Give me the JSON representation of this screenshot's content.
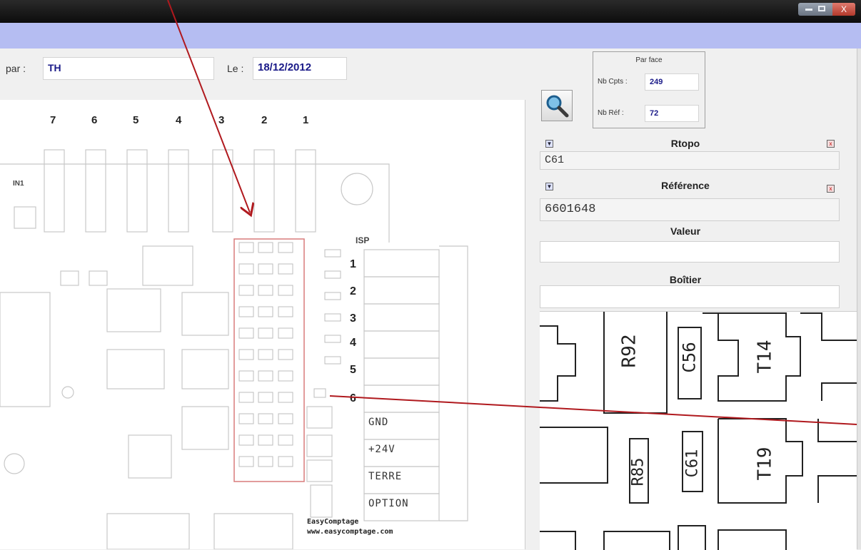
{
  "window": {
    "close_glyph": "X"
  },
  "header": {
    "par_label": "par :",
    "par_value": "TH",
    "date_label": "Le :",
    "date_value": "18/12/2012"
  },
  "per_face": {
    "title": "Par face",
    "nb_cpts_label": "Nb Cpts :",
    "nb_cpts_value": "249",
    "nb_ref_label": "Nb Réf :",
    "nb_ref_value": "72"
  },
  "panel": {
    "rtopo_label": "Rtopo",
    "rtopo_value": "C61",
    "reference_label": "Référence",
    "reference_value": "6601648",
    "valeur_label": "Valeur",
    "valeur_value": "",
    "boitier_label": "Boîtier",
    "boitier_value": "",
    "clear_glyph": "x",
    "dropdown_glyph": "▼"
  },
  "drawing": {
    "column_numbers": [
      "7",
      "6",
      "5",
      "4",
      "3",
      "2",
      "1"
    ],
    "in_label": "IN1",
    "isp_label": "ISP",
    "isp_numbers": [
      "1",
      "2",
      "3",
      "4",
      "5",
      "6"
    ],
    "connectors": [
      "GND",
      "+24V",
      "TERRE",
      "OPTION"
    ],
    "brand": "EasyComptage",
    "url": "www.easycomptage.com"
  },
  "zoom_labels": [
    "R92",
    "C56",
    "T14",
    "R85",
    "C61",
    "T19"
  ],
  "colors": {
    "title_bar": "#111111",
    "menu_bar": "#b5bdf2",
    "annotation_arrow": "#b0191e",
    "field_text": "#1a1a88",
    "highlight_box": "#d97b7b"
  }
}
